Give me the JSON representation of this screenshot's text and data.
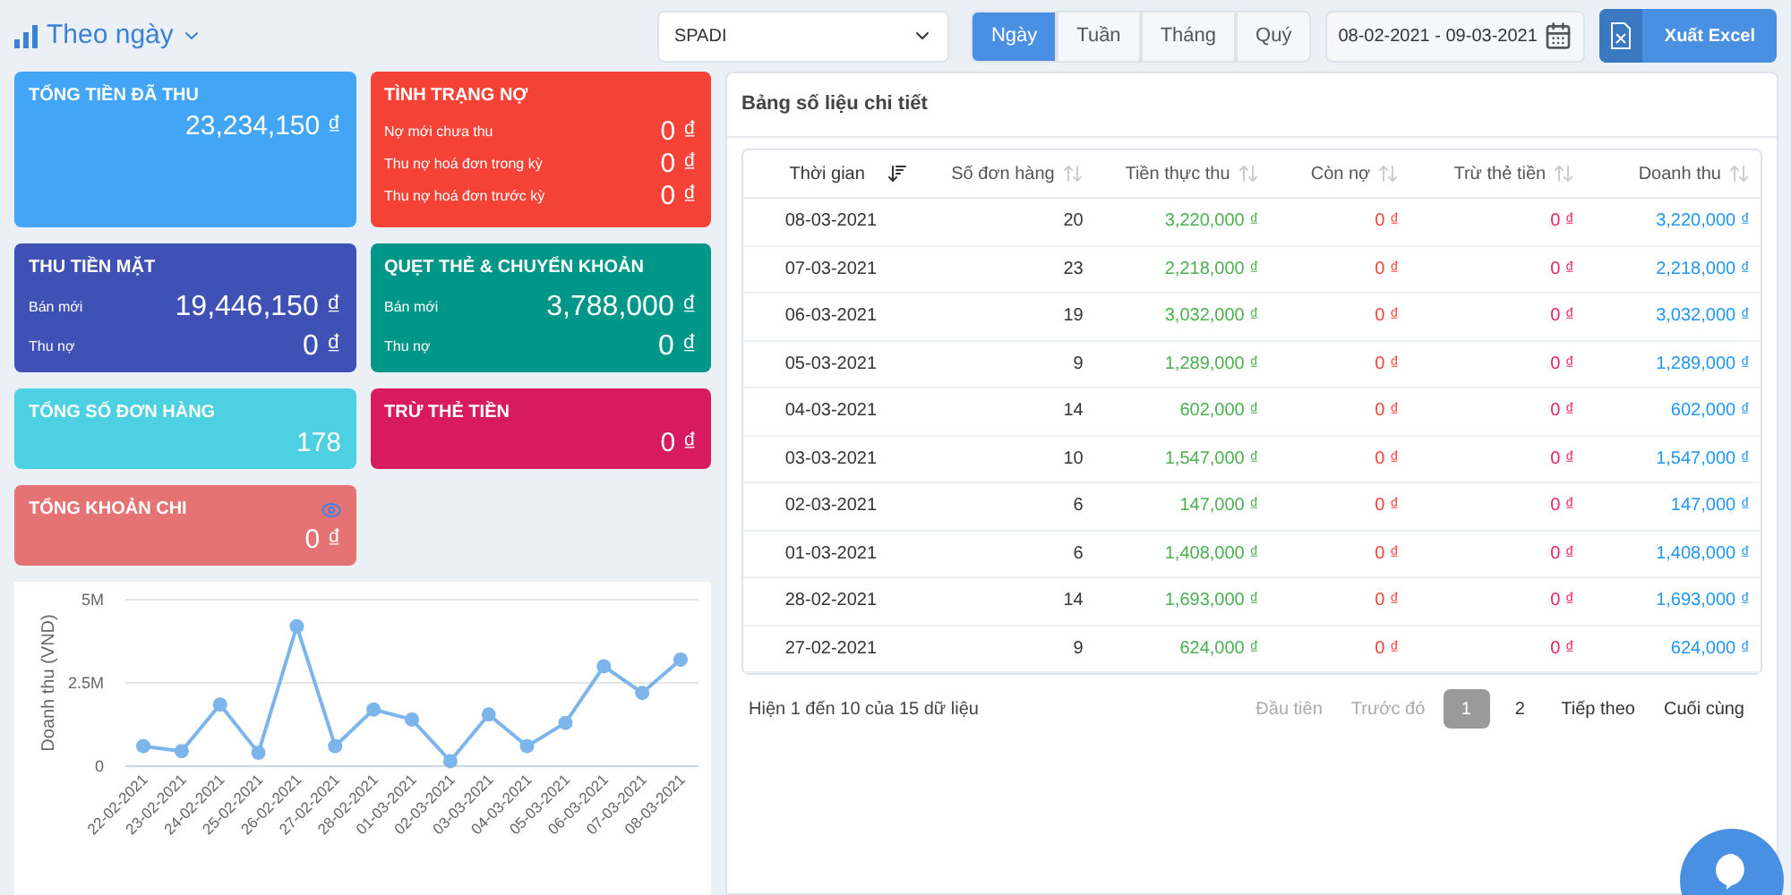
{
  "header": {
    "title": "Theo ngày",
    "store": "SPADI",
    "periods": [
      {
        "label": "Ngày",
        "selected": true
      },
      {
        "label": "Tuần",
        "selected": false
      },
      {
        "label": "Tháng",
        "selected": false
      },
      {
        "label": "Quý",
        "selected": false
      }
    ],
    "date_range": "08-02-2021 - 09-03-2021",
    "export": "Xuất Excel"
  },
  "cards": [
    {
      "kind": "total",
      "title": "TỔNG TIỀN ĐÃ THU",
      "color": "#42a5f5",
      "value": "23,234,150 ₫"
    },
    {
      "kind": "lines",
      "title": "TÌNH TRẠNG NỢ",
      "color": "#f44336",
      "lines": [
        {
          "label": "Nợ mới chưa thu",
          "value": "0 ₫"
        },
        {
          "label": "Thu nợ hoá đơn trong kỳ",
          "value": "0 ₫"
        },
        {
          "label": "Thu nợ hoá đơn trước kỳ",
          "value": "0 ₫"
        }
      ]
    },
    {
      "kind": "lines",
      "title": "THU TIỀN MẶT",
      "color": "#3f51b5",
      "lines": [
        {
          "label": "Bán mới",
          "value": "19,446,150 ₫"
        },
        {
          "label": "Thu nợ",
          "value": "0 ₫"
        }
      ]
    },
    {
      "kind": "lines",
      "title": "QUẸT THẺ & CHUYỂN KHOẢN",
      "color": "#009688",
      "lines": [
        {
          "label": "Bán mới",
          "value": "3,788,000 ₫"
        },
        {
          "label": "Thu nợ",
          "value": "0 ₫"
        }
      ]
    },
    {
      "kind": "total",
      "title": "TỔNG SỐ ĐƠN HÀNG",
      "color": "#4dd0e1",
      "value": "178"
    },
    {
      "kind": "total",
      "title": "TRỪ THẺ TIỀN",
      "color": "#d81b60",
      "value": "0 ₫"
    },
    {
      "kind": "eye",
      "title": "TỔNG KHOẢN CHI",
      "color": "#e57373",
      "value": "0 ₫"
    }
  ],
  "chart": {
    "chart_data": {
      "type": "line",
      "ylabel": "Doanh thu (VND)",
      "categories": [
        "22-02-2021",
        "23-02-2021",
        "24-02-2021",
        "25-02-2021",
        "26-02-2021",
        "27-02-2021",
        "28-02-2021",
        "01-03-2021",
        "02-03-2021",
        "03-03-2021",
        "04-03-2021",
        "05-03-2021",
        "06-03-2021",
        "07-03-2021",
        "08-03-2021"
      ],
      "series": [
        {
          "color": "#7cb5ec",
          "marker": true,
          "values": [
            0.6,
            0.45,
            1.85,
            0.4,
            4.2,
            0.6,
            1.7,
            1.4,
            0.15,
            1.55,
            0.6,
            1.3,
            3.0,
            2.2,
            3.2
          ]
        }
      ],
      "ylim": [
        0,
        5
      ],
      "yticks": [
        {
          "value": 0,
          "label": "0"
        },
        {
          "value": 2.5,
          "label": "2.5M"
        },
        {
          "value": 5,
          "label": "5M"
        }
      ]
    }
  },
  "table": {
    "title": "Bảng số liệu chi tiết",
    "columns": [
      {
        "label": "Thời gian",
        "sorted": true
      },
      {
        "label": "Số đơn hàng",
        "sorted": false
      },
      {
        "label": "Tiền thực thu",
        "sorted": false
      },
      {
        "label": "Còn nợ",
        "sorted": false
      },
      {
        "label": "Trừ thẻ tiền",
        "sorted": false
      },
      {
        "label": "Doanh thu",
        "sorted": false
      }
    ],
    "rows": [
      [
        "08-03-2021",
        "20",
        "3,220,000 ₫",
        "0 ₫",
        "0 ₫",
        "3,220,000 ₫"
      ],
      [
        "07-03-2021",
        "23",
        "2,218,000 ₫",
        "0 ₫",
        "0 ₫",
        "2,218,000 ₫"
      ],
      [
        "06-03-2021",
        "19",
        "3,032,000 ₫",
        "0 ₫",
        "0 ₫",
        "3,032,000 ₫"
      ],
      [
        "05-03-2021",
        "9",
        "1,289,000 ₫",
        "0 ₫",
        "0 ₫",
        "1,289,000 ₫"
      ],
      [
        "04-03-2021",
        "14",
        "602,000 ₫",
        "0 ₫",
        "0 ₫",
        "602,000 ₫"
      ],
      [
        "03-03-2021",
        "10",
        "1,547,000 ₫",
        "0 ₫",
        "0 ₫",
        "1,547,000 ₫"
      ],
      [
        "02-03-2021",
        "6",
        "147,000 ₫",
        "0 ₫",
        "0 ₫",
        "147,000 ₫"
      ],
      [
        "01-03-2021",
        "6",
        "1,408,000 ₫",
        "0 ₫",
        "0 ₫",
        "1,408,000 ₫"
      ],
      [
        "28-02-2021",
        "14",
        "1,693,000 ₫",
        "0 ₫",
        "0 ₫",
        "1,693,000 ₫"
      ],
      [
        "27-02-2021",
        "9",
        "624,000 ₫",
        "0 ₫",
        "0 ₫",
        "624,000 ₫"
      ]
    ],
    "summary": "Hiện 1 đến 10 của 15 dữ liệu",
    "pages": [
      {
        "label": "Đầu tiên",
        "kind": "nav",
        "disabled": true
      },
      {
        "label": "Trước đó",
        "kind": "nav",
        "disabled": true
      },
      {
        "label": "1",
        "kind": "page",
        "selected": true
      },
      {
        "label": "2",
        "kind": "page",
        "selected": false
      },
      {
        "label": "Tiếp theo",
        "kind": "nav",
        "disabled": false
      },
      {
        "label": "Cuối cùng",
        "kind": "nav",
        "disabled": false
      }
    ]
  }
}
